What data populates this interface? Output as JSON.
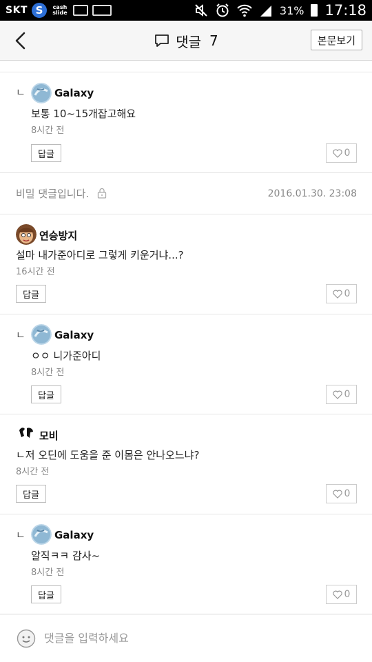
{
  "status_bar": {
    "carrier": "SKT",
    "cash_slide": "cash slide",
    "battery": "31%",
    "time": "17:18"
  },
  "header": {
    "title": "댓글",
    "count": "7",
    "view_post_label": "본문보기"
  },
  "reply_label": "답글",
  "comments": [
    {
      "author": "Galaxy",
      "text": "보통 10~15개잡고해요",
      "time": "8시간 전",
      "likes": "0",
      "is_reply": true
    },
    {
      "author": "연승방지",
      "text": "설마 내가준아디로 그렇게 키운거냐...?",
      "time": "16시간 전",
      "likes": "0",
      "is_reply": false
    },
    {
      "author": "Galaxy",
      "text": "ㅇㅇ 니가준아디",
      "time": "8시간 전",
      "likes": "0",
      "is_reply": true
    },
    {
      "author": "모비",
      "text": "ㄴ저 오딘에 도움을 준 이몸은 안나오느냐?",
      "time": "8시간 전",
      "likes": "0",
      "is_reply": false
    },
    {
      "author": "Galaxy",
      "text": "알직ㅋㅋ 감사~",
      "time": "8시간 전",
      "likes": "0",
      "is_reply": true
    }
  ],
  "secret_comment": {
    "text": "비밀 댓글입니다.",
    "date": "2016.01.30. 23:08"
  },
  "input": {
    "placeholder": "댓글을 입력하세요"
  }
}
